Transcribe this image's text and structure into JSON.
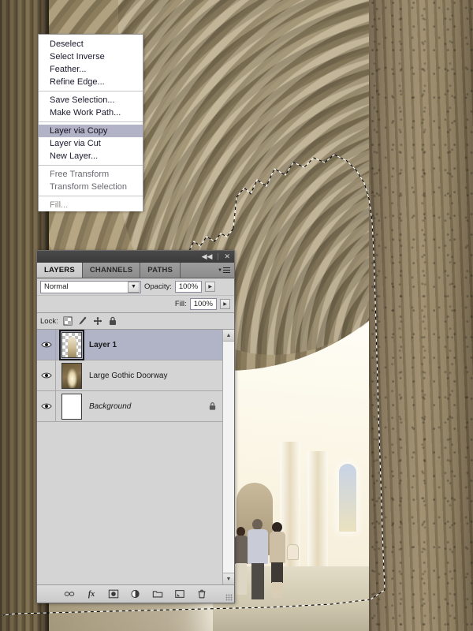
{
  "context_menu": {
    "groups": [
      [
        {
          "label": "Deselect",
          "state": "normal"
        },
        {
          "label": "Select Inverse",
          "state": "normal"
        },
        {
          "label": "Feather...",
          "state": "normal"
        },
        {
          "label": "Refine Edge...",
          "state": "normal"
        }
      ],
      [
        {
          "label": "Save Selection...",
          "state": "normal"
        },
        {
          "label": "Make Work Path...",
          "state": "normal"
        }
      ],
      [
        {
          "label": "Layer via Copy",
          "state": "selected"
        },
        {
          "label": "Layer via Cut",
          "state": "normal"
        },
        {
          "label": "New Layer...",
          "state": "normal"
        }
      ],
      [
        {
          "label": "Free Transform",
          "state": "dim"
        },
        {
          "label": "Transform Selection",
          "state": "dim"
        }
      ],
      [
        {
          "label": "Fill...",
          "state": "ghost"
        }
      ]
    ],
    "highlight_color": "#b3b3c8"
  },
  "layers_panel": {
    "titlebar": {
      "collapse_icon": "double-chevron-left-icon",
      "collapse_glyph": "◀◀",
      "close_icon": "close-icon",
      "close_glyph": "✕"
    },
    "tabs": [
      {
        "label": "LAYERS",
        "active": true
      },
      {
        "label": "CHANNELS",
        "active": false
      },
      {
        "label": "PATHS",
        "active": false
      }
    ],
    "panel_menu_icon": "panel-menu-hamburger-icon",
    "blend_mode": {
      "value": "Normal",
      "dropdown_icon": "chevron-down-icon",
      "dropdown_glyph": "▼"
    },
    "opacity": {
      "label": "Opacity:",
      "value": "100%",
      "stepper_icon": "stepper-arrow-icon",
      "stepper_glyph": "▶"
    },
    "fill": {
      "label": "Fill:",
      "value": "100%",
      "stepper_icon": "stepper-arrow-icon",
      "stepper_glyph": "▶"
    },
    "lock": {
      "label": "Lock:",
      "icons": [
        "lock-transparency-icon",
        "lock-image-pixels-icon",
        "lock-position-icon",
        "lock-all-icon"
      ]
    },
    "layers": [
      {
        "name": "Layer 1",
        "visible": true,
        "selected": true,
        "style": "bold",
        "thumbnail": "transparent-doorway-cutout",
        "locked": false
      },
      {
        "name": "Large Gothic Doorway",
        "visible": true,
        "selected": false,
        "style": "normal",
        "thumbnail": "photo-archway",
        "locked": false
      },
      {
        "name": "Background",
        "visible": true,
        "selected": false,
        "style": "italic",
        "thumbnail": "white-fill",
        "locked": true
      }
    ],
    "scrollbar": {
      "up_icon": "scroll-up-arrow-icon",
      "up_glyph": "▲",
      "down_icon": "scroll-down-arrow-icon",
      "down_glyph": "▼"
    },
    "footer_buttons": [
      {
        "name": "link-layers-button",
        "icon": "link-icon",
        "glyph": "⚭"
      },
      {
        "name": "layer-style-button",
        "icon": "fx-icon",
        "glyph": "fx"
      },
      {
        "name": "add-layer-mask-button",
        "icon": "layer-mask-icon",
        "glyph": ""
      },
      {
        "name": "new-adjustment-layer-button",
        "icon": "half-filled-circle-icon",
        "glyph": ""
      },
      {
        "name": "new-group-button",
        "icon": "folder-icon",
        "glyph": ""
      },
      {
        "name": "new-layer-button",
        "icon": "new-layer-icon",
        "glyph": ""
      },
      {
        "name": "delete-layer-button",
        "icon": "trash-icon",
        "glyph": ""
      }
    ],
    "colors": {
      "panel_bg": "#d4d4d4",
      "selected_row": "#b0b4c6",
      "titlebar": "#3a3a3a",
      "active_tab": "#d6d6d6"
    }
  },
  "canvas": {
    "description": "Gothic cathedral archway interior photograph with active marching-ants selection around the bright doorway opening",
    "selection_active": true,
    "people_count": 3
  }
}
